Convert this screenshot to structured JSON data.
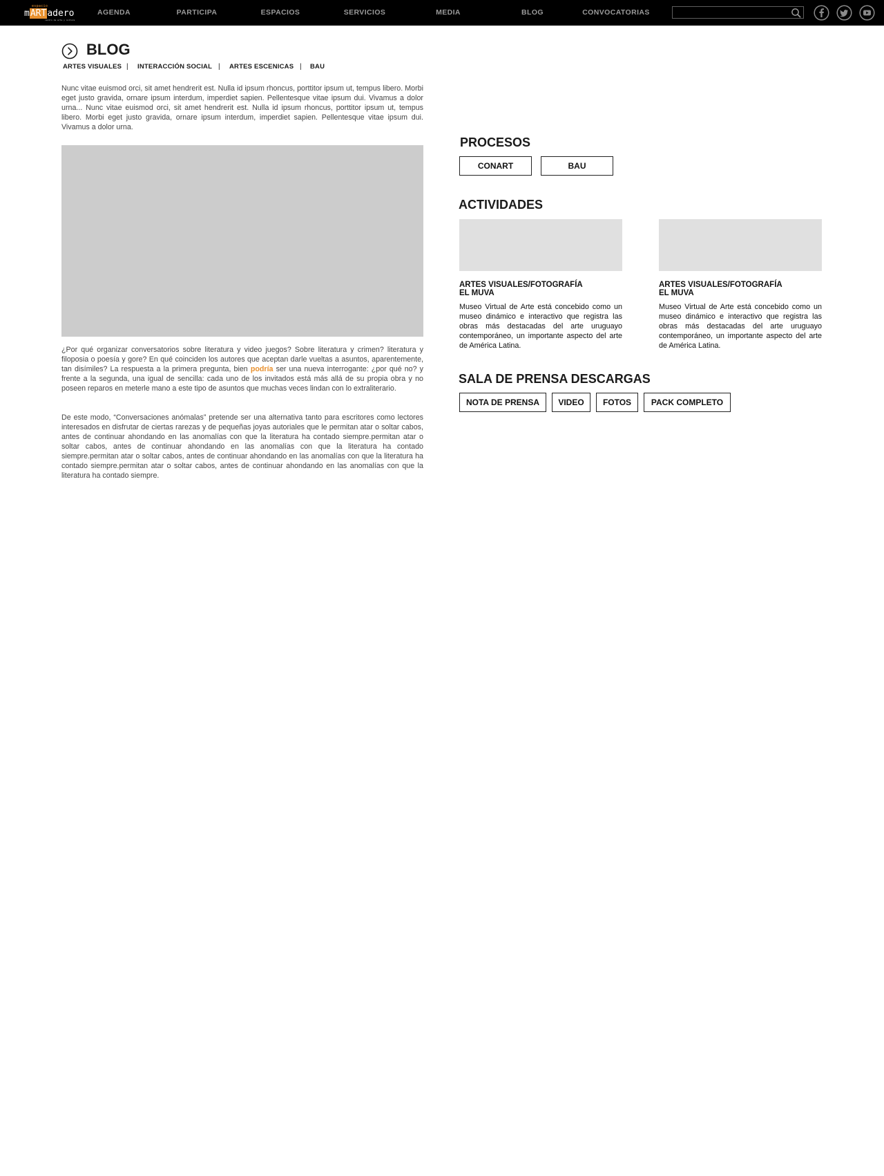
{
  "header": {
    "logo": {
      "sup": "espacio",
      "pre": "m",
      "art": "ART",
      "post": "adero",
      "sub": "centro de arte y cultura"
    },
    "nav": [
      "AGENDA",
      "PARTICIPA",
      "ESPACIOS",
      "SERVICIOS",
      "MEDIA",
      "BLOG",
      "CONVOCATORIAS"
    ],
    "search": {
      "placeholder": "",
      "icon": "search-icon"
    },
    "social": [
      {
        "name": "facebook",
        "icon": "facebook-icon",
        "glyph": "f"
      },
      {
        "name": "twitter",
        "icon": "twitter-icon",
        "glyph": "t"
      },
      {
        "name": "youtube",
        "icon": "youtube-icon",
        "glyph": "y"
      }
    ]
  },
  "blog": {
    "title": "BLOG",
    "title_icon": "chevron-right-circle-icon",
    "categories": [
      "ARTES VISUALES",
      "INTERACCIÓN SOCIAL",
      "ARTES ESCENICAS",
      "BAU"
    ],
    "separator": "|",
    "intro": "Nunc vitae euismod orci, sit amet hendrerit est. Nulla id ipsum rhoncus, porttitor ipsum ut, tempus libero. Morbi eget justo gravida, ornare ipsum interdum, imperdiet sapien. Pellentesque vitae ipsum dui. Vivamus a dolor urna... Nunc vitae euismod orci, sit amet hendrerit est. Nulla id ipsum rhoncus, porttitor ipsum ut, tempus libero. Morbi eget justo gravida, ornare ipsum interdum, imperdiet sapien. Pellentesque vitae ipsum dui. Vivamus a dolor urna.",
    "body1_pre": "¿Por qué organizar conversatorios sobre literatura y video juegos? Sobre literatura y crimen? literatura y filoposia o poesía y gore? En qué coinciden los autores que aceptan darle vueltas a asuntos, aparentemente, tan disímiles? La respuesta a la primera pregunta, bien ",
    "body1_highlight": "podría",
    "body1_post": " ser una nueva interrogante: ¿por qué no? y frente a la segunda, una igual de sencilla: cada uno de los invitados está más allá de su propia obra y no poseen reparos en meterle mano a este tipo de asuntos que muchas veces lindan con lo extraliterario.",
    "body2": "De este modo, “Conversaciones anómalas” pretende ser una alternativa tanto para escritores como lectores interesados en disfrutar de ciertas rarezas y de pequeñas joyas autoriales que le permitan atar o soltar cabos, antes de continuar ahondando en las anomalías con que la literatura ha contado siempre.permitan atar o soltar cabos, antes de continuar ahondando en las anomalías con que la literatura ha contado siempre.permitan atar o soltar cabos, antes de continuar ahondando en las anomalías con que la literatura ha contado siempre.permitan atar o soltar cabos, antes de continuar ahondando en las anomalías con que la literatura ha contado siempre."
  },
  "procesos": {
    "title": "PROCESOS",
    "buttons": [
      "CONART",
      "BAU"
    ]
  },
  "actividades": {
    "title": "ACTIVIDADES",
    "items": [
      {
        "title_line1": "ARTES VISUALES/FOTOGRAFÍA",
        "title_line2": "EL MUVA",
        "description": "Museo Virtual de Arte está concebido como un museo dinámico e interactivo que registra las obras más destacadas del arte uruguayo contemporáneo, un importante aspecto del arte de América Latina."
      },
      {
        "title_line1": "ARTES VISUALES/FOTOGRAFÍA",
        "title_line2": "EL MUVA",
        "description": "Museo Virtual de Arte está concebido como un museo dinámico e interactivo que registra las obras más destacadas del arte uruguayo contemporáneo, un importante aspecto del arte de América Latina."
      }
    ]
  },
  "prensa": {
    "title": "SALA DE PRENSA DESCARGAS",
    "buttons": [
      "NOTA DE PRENSA",
      "VIDEO",
      "FOTOS",
      "PACK COMPLETO"
    ]
  },
  "colors": {
    "topbar": "#000000",
    "nav_text": "#9a9a9a",
    "accent": "#e8912f",
    "image_placeholder": "#cccccc",
    "card_placeholder": "#e0e0e0"
  }
}
